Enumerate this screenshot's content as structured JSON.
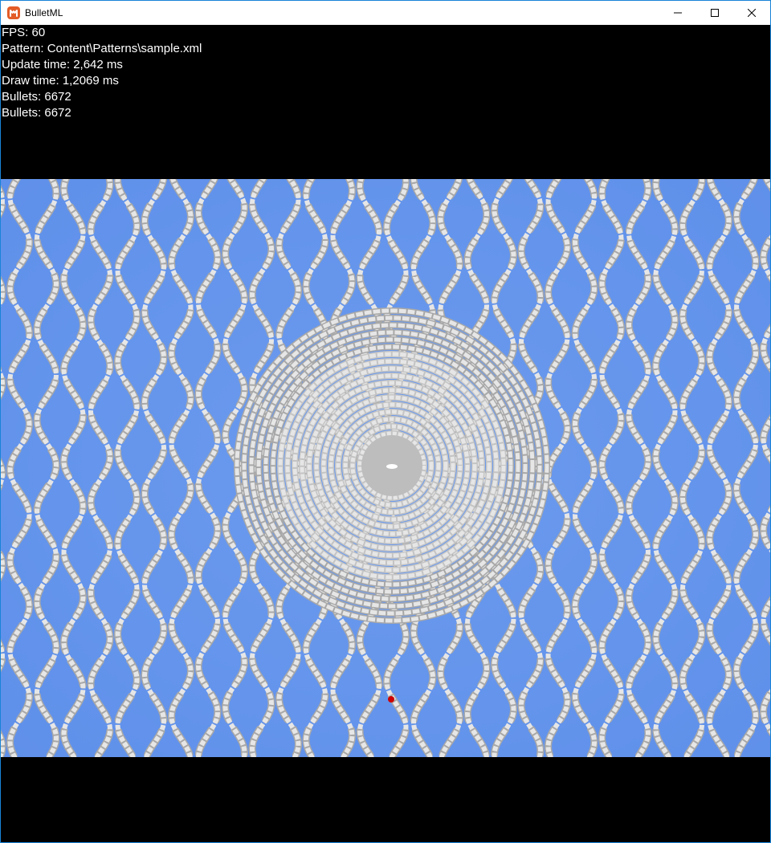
{
  "window": {
    "title": "BulletML",
    "icon": "monogame-logo-icon",
    "controls": [
      "minimize-icon",
      "maximize-icon",
      "close-icon"
    ]
  },
  "hud": {
    "fps": "FPS: 60",
    "pattern": "Pattern: Content\\Patterns\\sample.xml",
    "update_time": "Update time: 2,642 ms",
    "draw_time": "Draw time: 1,2069 ms",
    "bullets_1": "Bullets: 6672",
    "bullets_2": "Bullets: 6672"
  },
  "colors": {
    "playfield_background": "#6495ed",
    "letterbox": "#000000",
    "bullet_fill": "#e6e6e6",
    "bullet_outline": "#a8a8a8",
    "player": "#cc0000",
    "app_icon": "#e35c27"
  }
}
